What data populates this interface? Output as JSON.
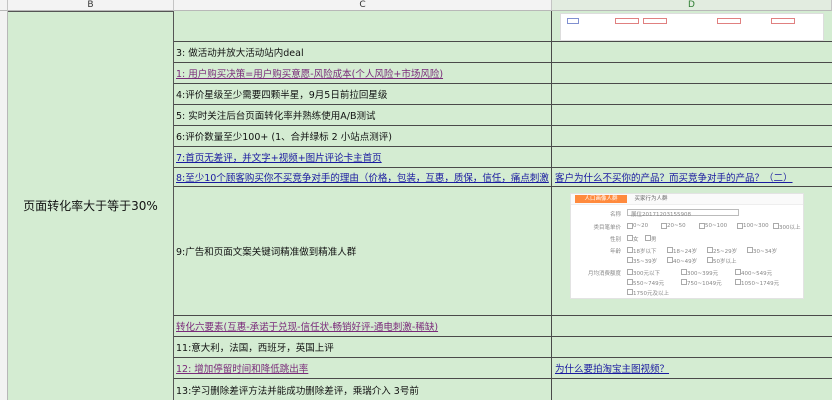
{
  "columns": {
    "b": "B",
    "c": "C",
    "d": "D"
  },
  "merged_label": "页面转化率大于等于30%",
  "rows": [
    {
      "c": "",
      "d": ""
    },
    {
      "c": "3: 做活动并放大活动站内deal",
      "d": ""
    },
    {
      "c": "1: 用户购买决策=用户购买意愿-风险成本(个人风险+市场风险)",
      "d": ""
    },
    {
      "c": "4:评价星级至少需要四颗半星，9月5日前拉回星级",
      "d": ""
    },
    {
      "c": "5: 实时关注后台页面转化率并熟练使用A/B测试",
      "d": ""
    },
    {
      "c": "6:评价数量至少100+ (1、合并绿标 2 小站点测评)",
      "d": ""
    },
    {
      "c": "7:首页无差评，并文字+视频+图片评论卡主首页",
      "d": ""
    },
    {
      "c": "8:至少10个顾客购买你不买竞争对手的理由（价格，包装，互惠，质保，信任，痛点刺激",
      "d": "客户为什么不买你的产品？而买竞争对手的产品？（二）"
    },
    {
      "c": "9:广告和页面文案关键词精准做到精准人群",
      "d": ""
    },
    {
      "c": "转化六要素(互惠-承诺于兑现-信任状-畅销好评-通电刺激-稀缺)",
      "d": ""
    },
    {
      "c": "11:意大利，法国，西班牙，英国上评",
      "d": ""
    },
    {
      "c": "12: 增加停留时间和降低跳出率",
      "d": "为什么要拍淘宝主图视频？"
    },
    {
      "c": "13:学习删除差评方法并能成功删除差评，乘瑞介入  3号前",
      "d": ""
    }
  ],
  "screenshot": {
    "tab_active": "人口画像人群",
    "tab_other": "买家行为人群",
    "labels": [
      "名称",
      "类目笔单价",
      "性别",
      "年龄",
      "月均消费额度"
    ],
    "name_value": "展位20171203155908",
    "price_options": [
      "0~20",
      "20~50",
      "50~100",
      "100~300",
      "300以上"
    ],
    "gender_options": [
      "女",
      "男"
    ],
    "age_options": [
      "18岁以下",
      "18~24岁",
      "25~29岁",
      "30~34岁",
      "35~39岁",
      "40~49岁",
      "50岁以上"
    ],
    "spend_options": [
      "300元以下",
      "300~399元",
      "400~549元",
      "550~749元",
      "750~1049元",
      "1050~1749元",
      "1750元及以上"
    ]
  }
}
